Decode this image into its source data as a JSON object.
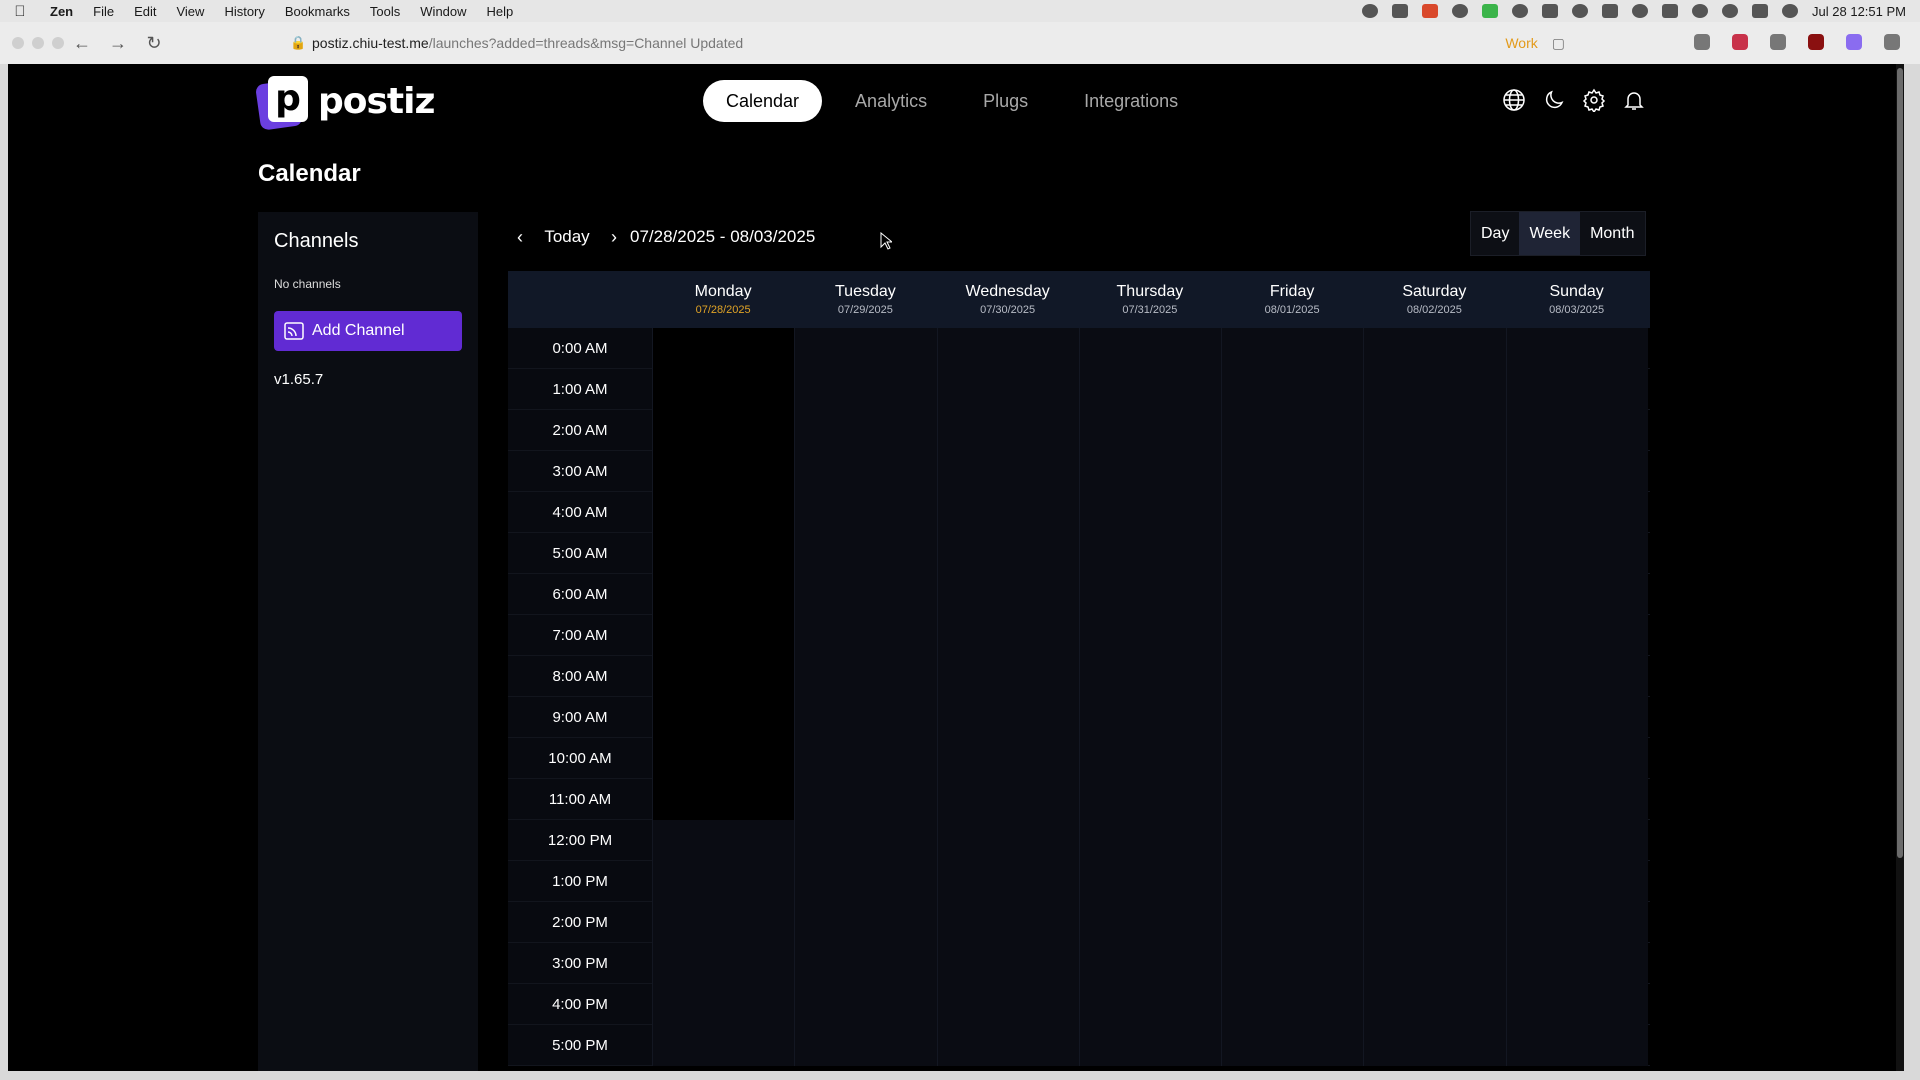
{
  "menubar": {
    "app_name": "Zen",
    "items": [
      "File",
      "Edit",
      "View",
      "History",
      "Bookmarks",
      "Tools",
      "Window",
      "Help"
    ],
    "clock": "Jul 28  12:51 PM"
  },
  "browser": {
    "url_host": "postiz.chiu-test.me",
    "url_path": "/launches?added=threads&msg=Channel Updated",
    "workspace": "Work"
  },
  "app": {
    "logo_letter": "p",
    "logo_text": "postiz",
    "nav": {
      "calendar": "Calendar",
      "analytics": "Analytics",
      "plugs": "Plugs",
      "integrations": "Integrations"
    },
    "page_title": "Calendar"
  },
  "sidebar": {
    "heading": "Channels",
    "empty_text": "No channels",
    "add_button": "Add Channel",
    "version": "v1.65.7"
  },
  "calendar": {
    "today_label": "Today",
    "range": "07/28/2025 - 08/03/2025",
    "views": {
      "day": "Day",
      "week": "Week",
      "month": "Month"
    },
    "active_view": "Week",
    "days": [
      {
        "name": "Monday",
        "date": "07/28/2025",
        "today": true
      },
      {
        "name": "Tuesday",
        "date": "07/29/2025"
      },
      {
        "name": "Wednesday",
        "date": "07/30/2025"
      },
      {
        "name": "Thursday",
        "date": "07/31/2025"
      },
      {
        "name": "Friday",
        "date": "08/01/2025"
      },
      {
        "name": "Saturday",
        "date": "08/02/2025"
      },
      {
        "name": "Sunday",
        "date": "08/03/2025"
      }
    ],
    "hours": [
      "0:00 AM",
      "1:00 AM",
      "2:00 AM",
      "3:00 AM",
      "4:00 AM",
      "5:00 AM",
      "6:00 AM",
      "7:00 AM",
      "8:00 AM",
      "9:00 AM",
      "10:00 AM",
      "11:00 AM",
      "12:00 PM",
      "1:00 PM",
      "2:00 PM",
      "3:00 PM",
      "4:00 PM",
      "5:00 PM"
    ],
    "past_hours_monday": 12
  },
  "colors": {
    "accent": "#612bd3",
    "today_date": "#e0a326",
    "background": "#000000"
  }
}
